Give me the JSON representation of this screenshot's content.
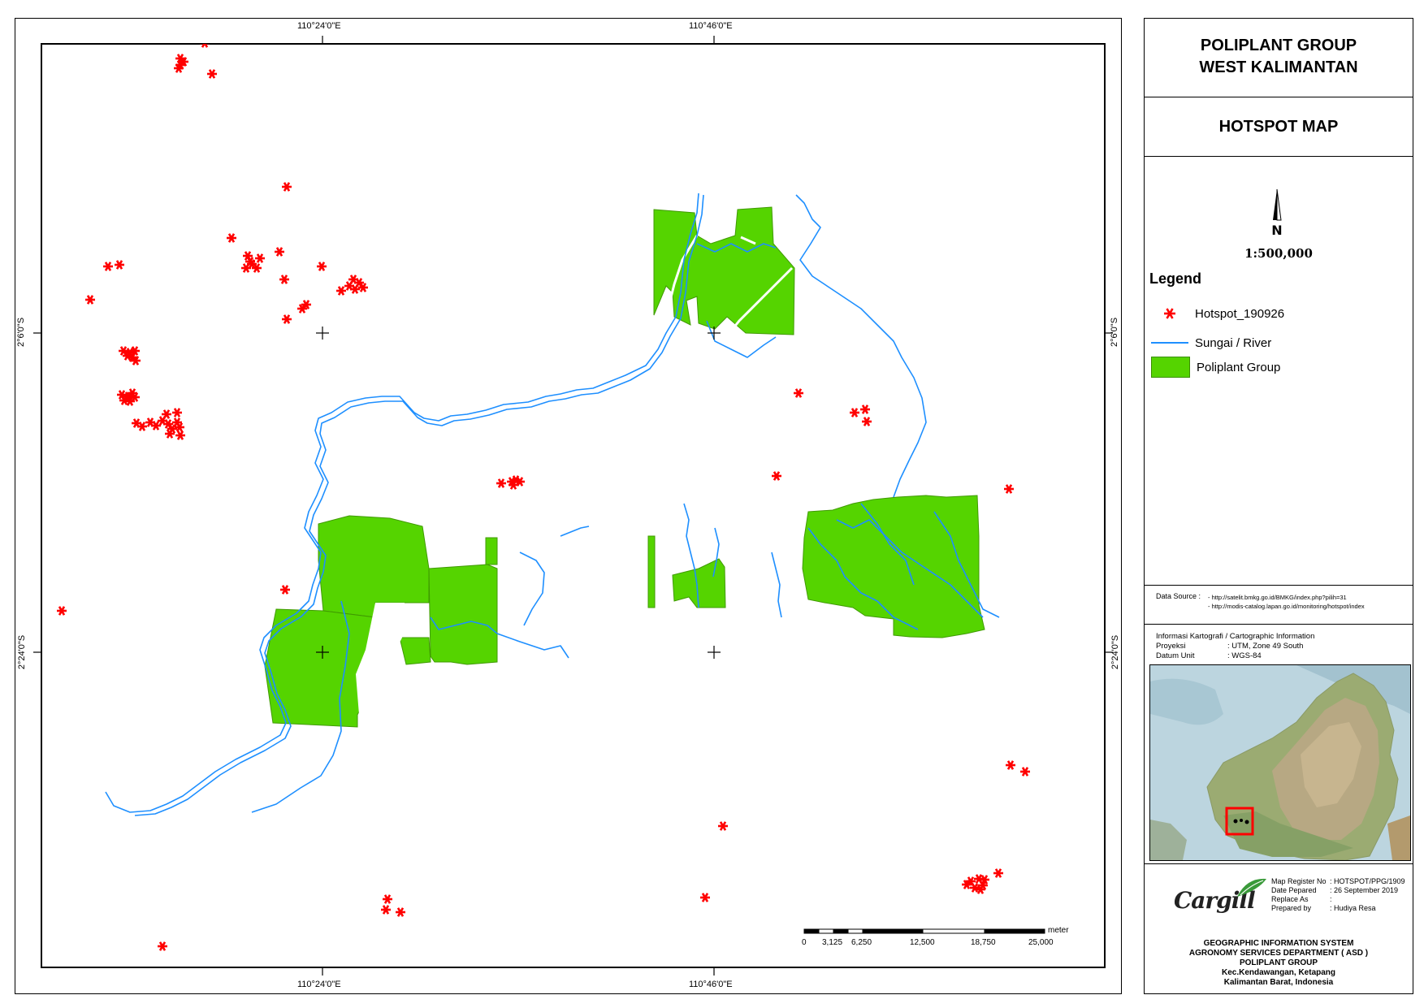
{
  "map": {
    "top_lon_labels": [
      "110°24'0\"E",
      "110°46'0\"E"
    ],
    "bottom_lon_labels": [
      "110°24'0\"E",
      "110°46'0\"E"
    ],
    "left_lat_labels": [
      "2°6'0\"S",
      "2°24'0\"S"
    ],
    "right_lat_labels": [
      "2°6'0\"S",
      "2°24'0\"S"
    ],
    "scalebar": {
      "unit": "meter",
      "ticks": [
        "0",
        "3,125",
        "6,250",
        "12,500",
        "18,750",
        "25,000"
      ]
    },
    "colors": {
      "hotspot": "#ff0000",
      "river": "#1e8fff",
      "plantation": "#55d400"
    }
  },
  "panel": {
    "title_line1": "POLIPLANT GROUP",
    "title_line2": "WEST KALIMANTAN",
    "map_title": "HOTSPOT MAP",
    "north_label": "N",
    "scale": "1:500,000",
    "legend_title": "Legend",
    "legend_items": [
      {
        "label": "Hotspot_190926",
        "icon": "hotspot-asterisk-icon"
      },
      {
        "label": "Sungai / River",
        "icon": "river-line-icon"
      },
      {
        "label": "Poliplant Group",
        "icon": "plantation-fill-icon"
      }
    ],
    "data_source_label": "Data Source :",
    "data_sources": [
      "- http://satelit.bmkg.go.id/BMKG/index.php?pilih=31",
      "- http://modis-catalog.lapan.go.id/monitoring/hotspot/index"
    ],
    "cart_info_title": "Informasi Kartografi / Cartographic Information",
    "projection_key": "Proyeksi",
    "projection_val": ": UTM, Zone 49 South",
    "datum_key": "Datum Unit",
    "datum_val": ": WGS-84",
    "logo_text": "Cargill",
    "meta": {
      "register_key": "Map Register No",
      "register_val": ": HOTSPOT/PPG/1909",
      "date_key": "Date Pepared",
      "date_val": ": 26 September 2019",
      "replace_key": "Replace As",
      "replace_val": ":",
      "prepared_key": "Prepared by",
      "prepared_val": ": Hudiya Resa"
    },
    "org_lines": [
      "GEOGRAPHIC INFORMATION SYSTEM",
      "AGRONOMY SERVICES DEPARTMENT ( ASD )",
      "POLIPLANT GROUP",
      "Kec.Kendawangan, Ketapang",
      "Kalimantan Barat, Indonesia"
    ]
  }
}
